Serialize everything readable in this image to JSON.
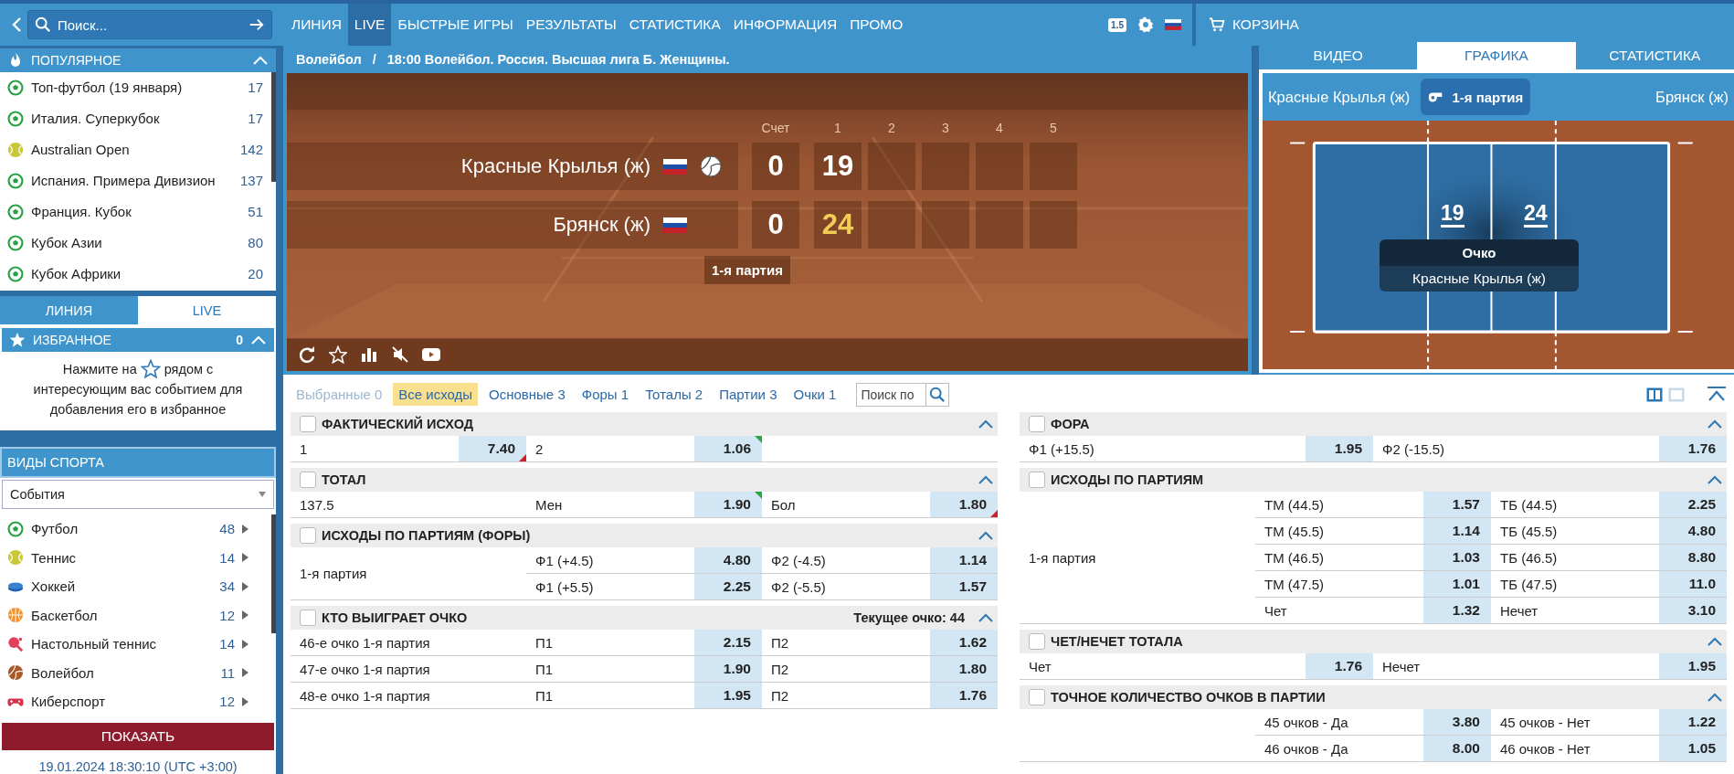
{
  "top_bar": {
    "search": {
      "placeholder": "Поиск..."
    },
    "nav": [
      {
        "label": "ЛИНИЯ",
        "selected": false
      },
      {
        "label": "LIVE",
        "selected": true
      },
      {
        "label": "БЫСТРЫЕ ИГРЫ",
        "selected": false
      },
      {
        "label": "РЕЗУЛЬТАТЫ",
        "selected": false
      },
      {
        "label": "СТАТИСТИКА",
        "selected": false
      },
      {
        "label": "ИНФОРМАЦИЯ",
        "selected": false
      },
      {
        "label": "ПРОМО",
        "selected": false
      }
    ],
    "odds_format": "1.5",
    "basket": "КОРЗИНА"
  },
  "sidebar": {
    "popular": {
      "title": "ПОПУЛЯРНОЕ",
      "expanded": true,
      "items": [
        {
          "name": "Топ-футбол (19 января)",
          "count": "17",
          "kind": "football"
        },
        {
          "name": "Италия. Суперкубок",
          "count": "17",
          "kind": "football"
        },
        {
          "name": "Australian Open",
          "count": "142",
          "kind": "tennis"
        },
        {
          "name": "Испания. Примера Дивизион",
          "count": "137",
          "kind": "football"
        },
        {
          "name": "Франция. Кубок",
          "count": "51",
          "kind": "football"
        },
        {
          "name": "Кубок Азии",
          "count": "80",
          "kind": "football"
        },
        {
          "name": "Кубок Африки",
          "count": "20",
          "kind": "football"
        }
      ]
    },
    "mode_tabs": [
      {
        "label": "ЛИНИЯ",
        "selected": false
      },
      {
        "label": "LIVE",
        "selected": true
      }
    ],
    "favorites": {
      "title": "ИЗБРАННОЕ",
      "count": "0",
      "expanded": true,
      "hint_before": "Нажмите на",
      "hint_after": "рядом с",
      "hint_rest": "интересующим вас событием для добавления его в избранное"
    },
    "sports": {
      "title": "ВИДЫ СПОРТА",
      "filter": "События",
      "items": [
        {
          "name": "Футбол",
          "count": "48",
          "kind": "football"
        },
        {
          "name": "Теннис",
          "count": "14",
          "kind": "tennis"
        },
        {
          "name": "Хоккей",
          "count": "34",
          "kind": "hockey"
        },
        {
          "name": "Баскетбол",
          "count": "12",
          "kind": "basketball"
        },
        {
          "name": "Настольный теннис",
          "count": "14",
          "kind": "table_tennis"
        },
        {
          "name": "Волейбол",
          "count": "11",
          "kind": "volleyball"
        },
        {
          "name": "Киберспорт",
          "count": "12",
          "kind": "esports"
        }
      ]
    },
    "show_button": "ПОКАЗАТЬ",
    "datetime": "19.01.2024 18:30:10 (UTC +3:00)"
  },
  "event": {
    "breadcrumb": [
      "Волейбол",
      "18:00 Волейбол. Россия. Высшая лига Б. Женщины."
    ],
    "breadcrumb_separator": "/",
    "score_header": {
      "total": "Счет",
      "periods": [
        "1",
        "2",
        "3",
        "4",
        "5"
      ]
    },
    "teams": [
      {
        "name": "Красные Крылья (ж)",
        "serving": true,
        "total": "0",
        "periods": [
          "19"
        ],
        "leading": false
      },
      {
        "name": "Брянск (ж)",
        "serving": false,
        "total": "0",
        "periods": [
          "24"
        ],
        "leading": true
      }
    ],
    "period_caption": "1-я партия"
  },
  "visualization": {
    "tabs": [
      {
        "label": "ВИДЕО",
        "selected": false
      },
      {
        "label": "ГРАФИКА",
        "selected": true
      },
      {
        "label": "СТАТИСТИКА",
        "selected": false
      }
    ],
    "home": "Красные Крылья (ж)",
    "away": "Брянск (ж)",
    "period": "1-я партия",
    "scores": [
      "19",
      "24"
    ],
    "event_title": "Очко",
    "event_team": "Красные Крылья (ж)"
  },
  "markets": {
    "filters": [
      {
        "label": "Выбранные 0",
        "selected": false,
        "disabled": true
      },
      {
        "label": "Все исходы",
        "selected": true,
        "disabled": false
      },
      {
        "label": "Основные 3",
        "selected": false,
        "disabled": false
      },
      {
        "label": "Форы 1",
        "selected": false,
        "disabled": false
      },
      {
        "label": "Тоталы 2",
        "selected": false,
        "disabled": false
      },
      {
        "label": "Партии 3",
        "selected": false,
        "disabled": false
      },
      {
        "label": "Очки 1",
        "selected": false,
        "disabled": false
      }
    ],
    "search": {
      "placeholder": "Поиск по"
    },
    "two_columns": true,
    "columns": [
      [
        {
          "title": "ФАКТИЧЕСКИЙ ИСХОД",
          "checked": false,
          "expanded": true,
          "rows": [
            {
              "kind": "three_way",
              "lines": [
                [
                  {
                    "name": "1",
                    "odd": "7.40",
                    "odds_up": false,
                    "odds_down": true
                  },
                  {
                    "name": "2",
                    "odd": "1.06",
                    "odds_up": true,
                    "odds_down": false
                  }
                ]
              ]
            }
          ]
        },
        {
          "title": "ТОТАЛ",
          "checked": false,
          "expanded": true,
          "rows": [
            {
              "kind": "labeled",
              "label": "137.5",
              "lines": [
                [
                  {
                    "name": "Мен",
                    "odd": "1.90",
                    "odds_up": true,
                    "odds_down": false
                  },
                  {
                    "name": "Бол",
                    "odd": "1.80",
                    "odds_up": false,
                    "odds_down": true
                  }
                ]
              ]
            }
          ]
        },
        {
          "title": "ИСХОДЫ ПО ПАРТИЯМ (ФОРЫ)",
          "checked": false,
          "expanded": true,
          "rows": [
            {
              "kind": "labeled",
              "label": "1-я партия",
              "lines": [
                [
                  {
                    "name": "Ф1 (+4.5)",
                    "odd": "4.80"
                  },
                  {
                    "name": "Ф2 (-4.5)",
                    "odd": "1.14"
                  }
                ],
                [
                  {
                    "name": "Ф1 (+5.5)",
                    "odd": "2.25"
                  },
                  {
                    "name": "Ф2 (-5.5)",
                    "odd": "1.57"
                  }
                ]
              ]
            }
          ]
        },
        {
          "title": "КТО ВЫИГРАЕТ ОЧКО",
          "note": "Текущее очко: 44",
          "checked": false,
          "expanded": true,
          "rows": [
            {
              "kind": "labeled",
              "label": "46-е очко 1-я партия",
              "lines": [
                [
                  {
                    "name": "П1",
                    "odd": "2.15"
                  },
                  {
                    "name": "П2",
                    "odd": "1.62"
                  }
                ]
              ]
            },
            {
              "kind": "labeled",
              "label": "47-е очко 1-я партия",
              "lines": [
                [
                  {
                    "name": "П1",
                    "odd": "1.90"
                  },
                  {
                    "name": "П2",
                    "odd": "1.80"
                  }
                ]
              ]
            },
            {
              "kind": "labeled",
              "label": "48-е очко 1-я партия",
              "lines": [
                [
                  {
                    "name": "П1",
                    "odd": "1.95"
                  },
                  {
                    "name": "П2",
                    "odd": "1.76"
                  }
                ]
              ]
            }
          ]
        }
      ],
      [
        {
          "title": "ФОРА",
          "checked": false,
          "expanded": true,
          "rows": [
            {
              "kind": "two_way",
              "lines": [
                [
                  {
                    "name": "Ф1 (+15.5)",
                    "odd": "1.95"
                  },
                  {
                    "name": "Ф2 (-15.5)",
                    "odd": "1.76"
                  }
                ]
              ]
            }
          ]
        },
        {
          "title": "ИСХОДЫ ПО ПАРТИЯМ",
          "checked": false,
          "expanded": true,
          "rows": [
            {
              "kind": "labeled",
              "label": "1-я партия",
              "lines": [
                [
                  {
                    "name": "ТМ (44.5)",
                    "odd": "1.57"
                  },
                  {
                    "name": "ТБ (44.5)",
                    "odd": "2.25"
                  }
                ],
                [
                  {
                    "name": "ТМ (45.5)",
                    "odd": "1.14"
                  },
                  {
                    "name": "ТБ (45.5)",
                    "odd": "4.80"
                  }
                ],
                [
                  {
                    "name": "ТМ (46.5)",
                    "odd": "1.03"
                  },
                  {
                    "name": "ТБ (46.5)",
                    "odd": "8.80"
                  }
                ],
                [
                  {
                    "name": "ТМ (47.5)",
                    "odd": "1.01"
                  },
                  {
                    "name": "ТБ (47.5)",
                    "odd": "11.0"
                  }
                ],
                [
                  {
                    "name": "Чет",
                    "odd": "1.32"
                  },
                  {
                    "name": "Нечет",
                    "odd": "3.10"
                  }
                ]
              ]
            }
          ]
        },
        {
          "title": "ЧЕТ/НЕЧЕТ ТОТАЛА",
          "checked": false,
          "expanded": true,
          "rows": [
            {
              "kind": "two_way",
              "lines": [
                [
                  {
                    "name": "Чет",
                    "odd": "1.76"
                  },
                  {
                    "name": "Нечет",
                    "odd": "1.95"
                  }
                ]
              ]
            }
          ]
        },
        {
          "title": "ТОЧНОЕ КОЛИЧЕСТВО ОЧКОВ В ПАРТИИ",
          "checked": false,
          "expanded": true,
          "rows": [
            {
              "kind": "labeled",
              "lines": [
                [
                  {
                    "name": "45 очков - Да",
                    "odd": "3.80"
                  },
                  {
                    "name": "45 очков - Нет",
                    "odd": "1.22"
                  }
                ],
                [
                  {
                    "name": "46 очков - Да",
                    "odd": "8.00"
                  },
                  {
                    "name": "46 очков - Нет",
                    "odd": "1.05"
                  }
                ]
              ]
            }
          ]
        }
      ]
    ]
  }
}
